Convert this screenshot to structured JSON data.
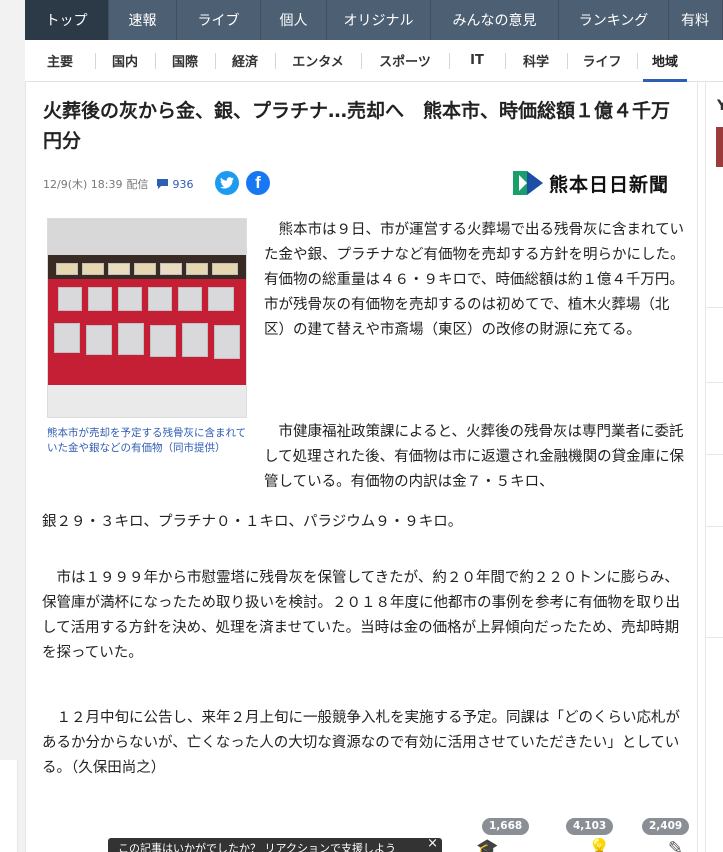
{
  "top_nav": {
    "items": [
      {
        "label": "トップ",
        "active": true
      },
      {
        "label": "速報"
      },
      {
        "label": "ライブ"
      },
      {
        "label": "個人"
      },
      {
        "label": "オリジナル"
      },
      {
        "label": "みんなの意見"
      },
      {
        "label": "ランキング"
      },
      {
        "label": "有料"
      }
    ]
  },
  "sub_nav": {
    "items": [
      {
        "label": "主要"
      },
      {
        "label": "国内"
      },
      {
        "label": "国際"
      },
      {
        "label": "経済"
      },
      {
        "label": "エンタメ"
      },
      {
        "label": "スポーツ"
      },
      {
        "label": "IT"
      },
      {
        "label": "科学"
      },
      {
        "label": "ライフ"
      },
      {
        "label": "地域",
        "active": true
      }
    ]
  },
  "article": {
    "headline": "火葬後の灰から金、銀、プラチナ…売却へ　熊本市、時価総額１億４千万円分",
    "datetime": "12/9(木) 18:39",
    "delivery": "配信",
    "comment_count": "936",
    "publisher": "熊本日日新聞",
    "photo_caption": "熊本市が売却を予定する残骨灰に含まれていた金や銀などの有価物（同市提供）",
    "paragraph_1": "　熊本市は９日、市が運営する火葬場で出る残骨灰に含まれていた金や銀、プラチナなど有価物を売却する方針を明らかにした。有価物の総重量は４６・９キロで、時価総額は約１億４千万円。市が残骨灰の有価物を売却するのは初めてで、植木火葬場（北区）の建て替えや市斎場（東区）の改修の財源に充てる。",
    "paragraph_2a": "　市健康福祉政策課によると、火葬後の残骨灰は専門業者に委託して処理された後、有価物は市に返還され金融機関の貸金庫に保管している。有価物の内訳は金７・５キロ、",
    "paragraph_2b": "銀２９・３キロ、プラチナ０・１キロ、パラジウム９・９キロ。",
    "paragraph_3": "　市は１９９９年から市慰霊塔に残骨灰を保管してきたが、約２０年間で約２２０トンに膨らみ、保管庫が満杯になったため取り扱いを検討。２０１８年度に他都市の事例を参考に有価物を取り出して活用する方針を決め、処理を済ませていた。当時は金の価格が上昇傾向だったため、売却時期を探っていた。",
    "paragraph_4": "　１２月中旬に公告し、来年２月上旬に一般競争入札を実施する予定。同課は「どのくらい応札があるか分からないが、亡くなった人の大切な資源なので有効に活用させていただきたい」としている。（久保田尚之）"
  },
  "reactions": {
    "learn_count": "1,668",
    "think_count": "4,103",
    "understand_count": "2,409"
  },
  "toast": {
    "text": "この記事はいかがでしたか？ リアクションで支援しよう"
  },
  "icons": {
    "comment": "comment-bubble-icon",
    "twitter": "twitter-icon",
    "facebook": "facebook-icon",
    "close": "close-icon"
  },
  "colors": {
    "nav_bg": "#4d5f73",
    "nav_active": "#2c3a48",
    "link_blue": "#2f5db3",
    "twitter": "#1d9bf0",
    "facebook": "#1877f2"
  }
}
